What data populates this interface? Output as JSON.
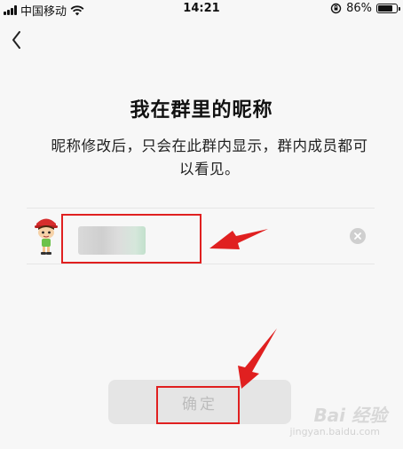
{
  "status_bar": {
    "carrier": "中国移动",
    "time": "14:21",
    "battery_percent": "86%",
    "battery_level": 0.86
  },
  "nav": {
    "back_icon": "chevron-left-icon"
  },
  "page": {
    "title": "我在群里的昵称",
    "description": "昵称修改后，只会在此群内显示，群内成员都可以看见。"
  },
  "nickname": {
    "value": "",
    "avatar": "cartoon-avatar",
    "clear_icon": "clear-icon"
  },
  "confirm_button": {
    "label": "确定"
  },
  "watermark": {
    "text": "Bai 经验",
    "url": "jingyan.baidu.com"
  },
  "colors": {
    "annotation": "#e02020",
    "button_bg": "#e5e5e5",
    "button_text": "#bcbcbc",
    "background": "#f7f7f7"
  }
}
